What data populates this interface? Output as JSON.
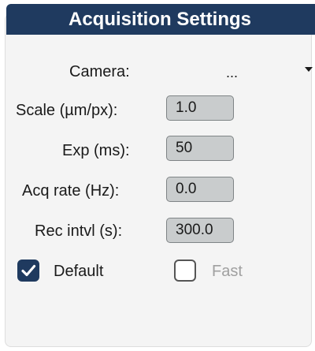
{
  "panel": {
    "title": "Acquisition Settings"
  },
  "camera": {
    "label": "Camera:",
    "selected": "..."
  },
  "fields": {
    "scale": {
      "label": "Scale (µm/px):",
      "value": "1.0"
    },
    "exposure": {
      "label": "Exp (ms):",
      "value": "50"
    },
    "acq_rate": {
      "label": "Acq rate (Hz):",
      "value": "0.0"
    },
    "rec_interval": {
      "label": "Rec intvl (s):",
      "value": "300.0"
    }
  },
  "options": {
    "default": {
      "label": "Default",
      "checked": true
    },
    "fast": {
      "label": "Fast",
      "checked": false
    }
  },
  "colors": {
    "accent": "#1f3a5f",
    "field_bg": "#c9cccd",
    "disabled_text": "#a0a0a0"
  },
  "icons": {
    "dropdown": "chevron-down-icon",
    "checked": "checkmark-icon"
  }
}
